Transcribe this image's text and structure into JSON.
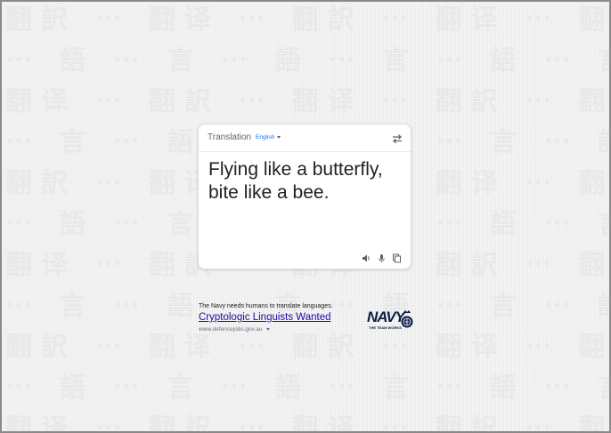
{
  "card": {
    "header_title": "Translation",
    "language": "English",
    "translated_text": "Flying like a butterfly, bite like a bee.",
    "icons": [
      "swap-icon",
      "speaker-icon",
      "microphone-icon",
      "copy-icon"
    ]
  },
  "ad": {
    "tagline": "The Navy needs humans to translate languages.",
    "headline": "Cryptologic Linguists Wanted",
    "url": "www.defencejobs.gov.au",
    "logo": {
      "word": "NAVY",
      "slogan": "THE TEAM WORKS"
    }
  },
  "colors": {
    "accent": "#1a73e8",
    "link": "#1a0dab",
    "navy": "#0b1f44"
  }
}
